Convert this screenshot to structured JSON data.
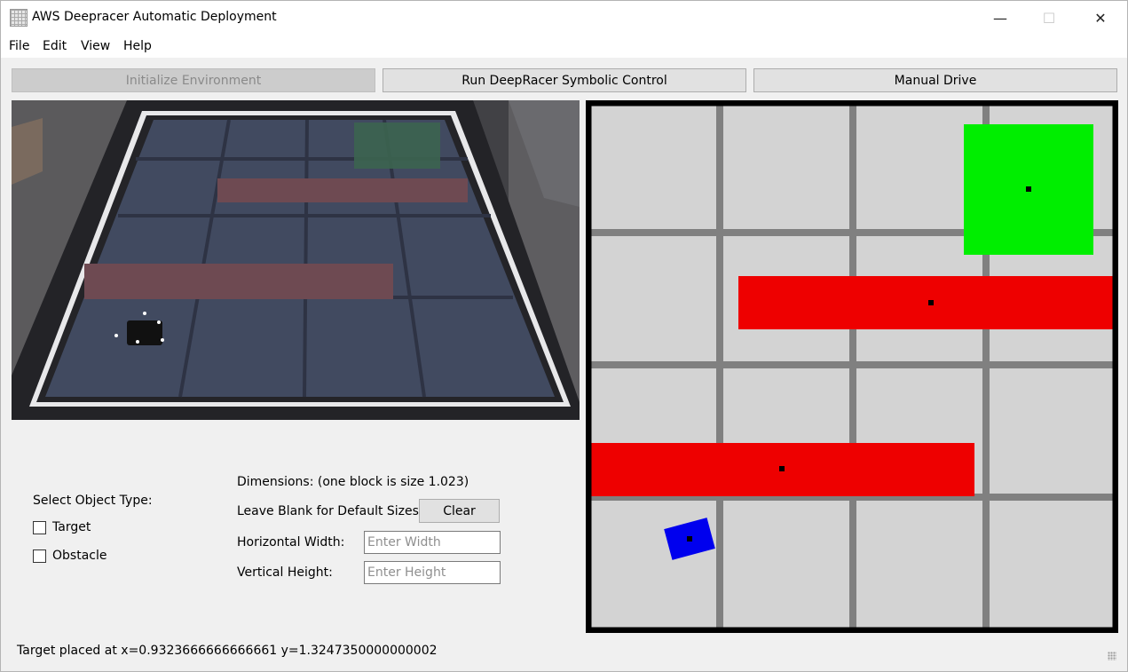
{
  "window": {
    "title": "AWS Deepracer Automatic Deployment",
    "controls": {
      "minimize": "—",
      "maximize": "☐",
      "close": "✕"
    }
  },
  "menu": [
    "File",
    "Edit",
    "View",
    "Help"
  ],
  "toolbar": {
    "init_label": "Initialize Environment",
    "run_label": "Run DeepRacer Symbolic Control",
    "manual_label": "Manual Drive"
  },
  "object_panel": {
    "heading": "Select Object Type:",
    "options": [
      {
        "label": "Target",
        "checked": false
      },
      {
        "label": "Obstacle",
        "checked": false
      }
    ]
  },
  "dimensions": {
    "heading": "Dimensions: (one block is size 1.023)",
    "blank_hint": "Leave Blank for Default Sizes",
    "clear_label": "Clear",
    "width_label": "Horizontal Width:",
    "width_placeholder": "Enter Width",
    "height_label": "Vertical Height:",
    "height_placeholder": "Enter Height"
  },
  "map": {
    "grid_blocks": 4,
    "colors": {
      "background": "#d3d3d3",
      "grid": "#808080",
      "border": "#000000",
      "target": "#00ee00",
      "obstacle": "#ee0000",
      "car": "#0000ee"
    },
    "objects": [
      {
        "type": "target",
        "color": "#00ee00"
      },
      {
        "type": "obstacle",
        "color": "#ee0000"
      },
      {
        "type": "obstacle",
        "color": "#ee0000"
      },
      {
        "type": "car",
        "color": "#0000ee"
      }
    ]
  },
  "status": "Target placed at x=0.9323666666666661 y=1.3247350000000002"
}
